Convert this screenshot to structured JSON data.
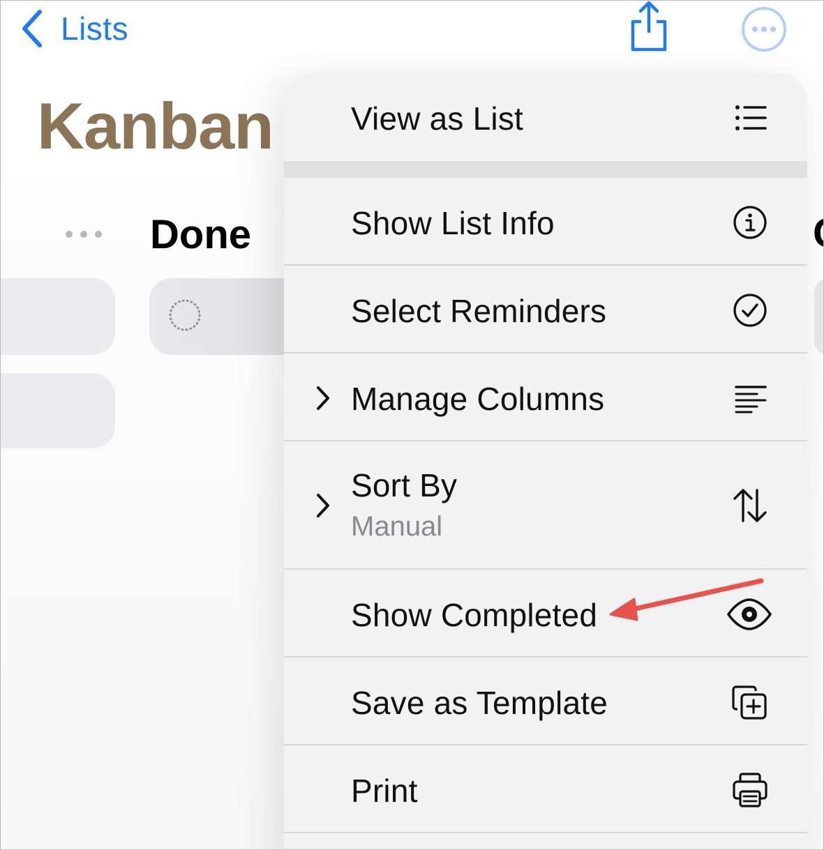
{
  "nav": {
    "back_label": "Lists"
  },
  "page": {
    "title": "Kanban",
    "column_title": "Done",
    "edge_column_peek": "C"
  },
  "menu": {
    "view_as_list": "View as List",
    "show_list_info": "Show List Info",
    "select_reminders": "Select Reminders",
    "manage_columns": "Manage Columns",
    "sort_by": "Sort By",
    "sort_by_value": "Manual",
    "show_completed": "Show Completed",
    "save_as_template": "Save as Template",
    "print": "Print"
  },
  "icons": {
    "back": "chevron-left-icon",
    "share": "share-icon",
    "more": "ellipsis-circle-icon",
    "view_as_list": "list-bullet-icon",
    "show_list_info": "info-circle-icon",
    "select_reminders": "checkmark-circle-icon",
    "manage_columns": "text-align-icon",
    "sort_by": "sort-arrows-icon",
    "show_completed": "eye-icon",
    "save_as_template": "plus-square-on-square-icon",
    "print": "printer-icon"
  },
  "colors": {
    "accent": "#1e7cf2",
    "list_title": "#8b7556",
    "annotation_arrow": "#e8524a"
  }
}
